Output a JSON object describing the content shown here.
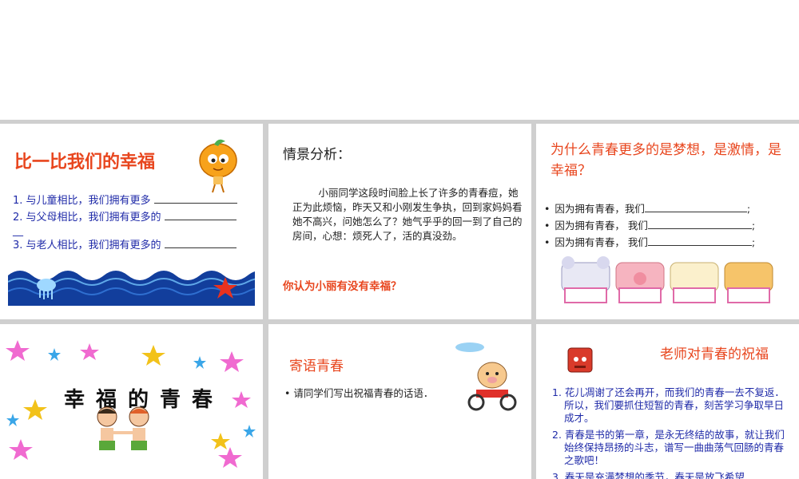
{
  "slide1": {
    "title": "比一比我们的幸福",
    "items": [
      "1. 与儿童相比，我们拥有更多",
      "2. 与父母相比，我们拥有更多的",
      "3. 与老人相比，我们拥有更多的"
    ],
    "wrap_dash": "__"
  },
  "slide2": {
    "heading": "情景分析：",
    "paragraph": "小丽同学这段时间脸上长了许多的青春痘，她正为此烦恼，昨天又和小刚发生争执，回到家妈妈看她不高兴，问她怎么了？她气乎乎的回一到了自己的房间，心想：烦死人了，活的真没劲。",
    "question": "你认为小丽有没有幸福？"
  },
  "slide3": {
    "title": "为什么青春更多的是梦想，是激情，是幸福？",
    "items": [
      "因为拥有青春，我们",
      "因为拥有青春，  我们",
      "因为拥有青春，  我们"
    ],
    "endings": [
      ";",
      ";",
      ";"
    ]
  },
  "slide4": {
    "title": "幸福的青春"
  },
  "slide5": {
    "heading": "寄语青春",
    "bullet": "请同学们写出祝福青春的话语．"
  },
  "slide6": {
    "title": "老师对青春的祝福",
    "items": [
      {
        "num": "1.",
        "text": "花儿凋谢了还会再开，而我们的青春一去不复返．所以，我们要抓住短暂的青春，刻苦学习争取早日成才。"
      },
      {
        "num": "2.",
        "text": "青春是书的第一章，是永无终结的故事，就让我们始终保持昂扬的斗志，谱写一曲曲荡气回肠的青春之歌吧！"
      },
      {
        "num": "3.",
        "text": "春天是充满梦想的季节，春天是放飞希望"
      }
    ]
  },
  "colors": {
    "title_red": "#e8461e",
    "list_blue": "#1f2aa8",
    "sea_blue": "#123e9c"
  },
  "icons": [
    "orange-character-icon",
    "jellyfish-icon",
    "starfish-icon",
    "animal-heads-icon",
    "stars-border-icon",
    "kids-icon",
    "cloud-icon",
    "pig-on-motorbike-icon",
    "red-book-icon"
  ]
}
